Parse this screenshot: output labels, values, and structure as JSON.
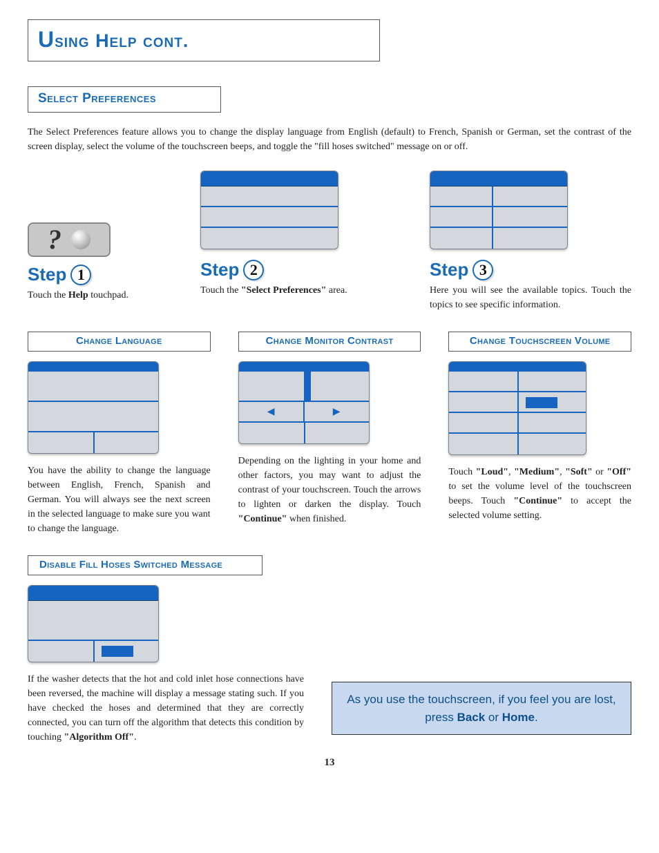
{
  "page_title": "Using Help cont.",
  "section_title": "Select Preferences",
  "intro": "The Select Preferences feature allows you to change the display language from English (default) to French, Spanish or German, set the contrast of the screen display, select the volume of the touchscreen beeps, and toggle the \"fill hoses switched\" message on or off.",
  "steps": {
    "s1": {
      "label": "Step",
      "num": "1",
      "text_pre": "Touch the ",
      "text_b": "Help",
      "text_post": " touchpad."
    },
    "s2": {
      "label": "Step",
      "num": "2",
      "text_pre": "Touch the ",
      "text_b": "\"Select Preferences\"",
      "text_post": " area."
    },
    "s3": {
      "label": "Step",
      "num": "3",
      "text": "Here you will see the available topics.  Touch the topics to see specific information."
    }
  },
  "topics": {
    "lang": {
      "title": "Change Language",
      "text": "You have the ability to change the language between English, French, Spanish and German.  You will always see the next screen in the selected language to make sure you want to change the language."
    },
    "contrast": {
      "title": "Change Monitor Contrast",
      "text_pre": "Depending on the lighting in your home and other factors, you may want to adjust the contrast of your touchscreen.  Touch the arrows to lighten or darken the display.  Touch ",
      "text_b": "\"Continue\"",
      "text_post": " when finished."
    },
    "volume": {
      "title": "Change Touchscreen Volume",
      "t1": "Touch ",
      "b1": "\"Loud\"",
      "t2": ", ",
      "b2": "\"Medium\"",
      "t3": ", ",
      "b3": "\"Soft\"",
      "t4": " or ",
      "b4": "\"Off\"",
      "t5": " to set the volume level of the touchscreen beeps.  Touch ",
      "b5": "\"Continue\"",
      "t6": " to accept the selected volume setting."
    }
  },
  "fill": {
    "title": "Disable Fill Hoses Switched Message",
    "text_pre": "If the washer detects that the hot and cold inlet hose connections have been reversed, the machine will display a message stating such.  If you have checked the hoses and determined that they are correctly connected, you can turn off the algorithm that detects this condition by touching ",
    "text_b": "\"Algorithm Off\"",
    "text_post": "."
  },
  "tip": {
    "t1": "As you use the touchscreen, if you feel you are lost, press ",
    "b1": "Back",
    "t2": " or ",
    "b2": "Home",
    "t3": "."
  },
  "page_number": "13",
  "glyphs": {
    "left_tri": "◀",
    "right_tri": "▶",
    "question": "?"
  }
}
